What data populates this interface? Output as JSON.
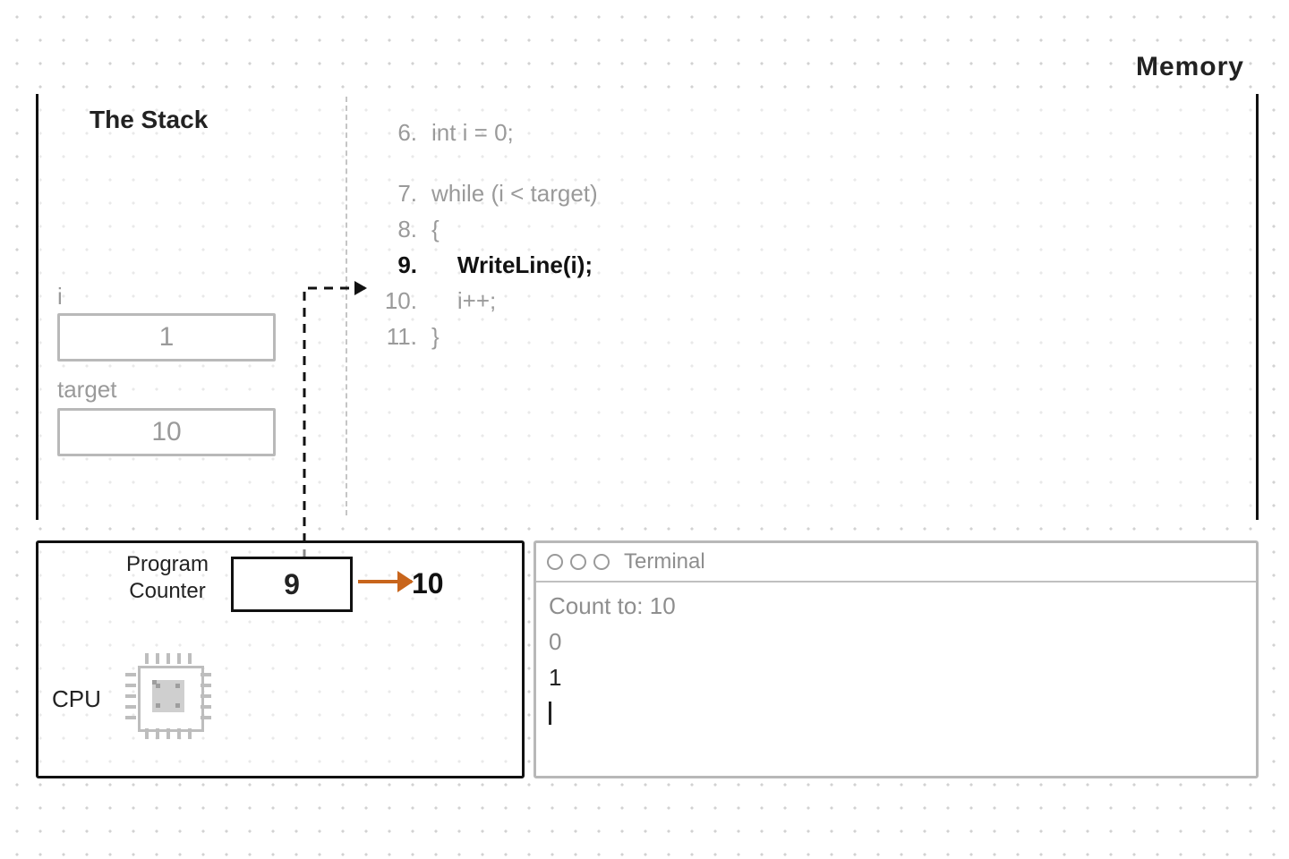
{
  "memory": {
    "panel_label": "Memory",
    "stack_title": "The Stack",
    "vars": {
      "i": {
        "label": "i",
        "value": "1"
      },
      "target": {
        "label": "target",
        "value": "10"
      }
    },
    "code": [
      {
        "n": "6.",
        "text": "int i = 0;",
        "active": false
      },
      {
        "n": "",
        "text": "",
        "active": false,
        "gap": true
      },
      {
        "n": "7.",
        "text": "while (i < target)",
        "active": false
      },
      {
        "n": "8.",
        "text": "{",
        "active": false
      },
      {
        "n": "9.",
        "text": "    WriteLine(i);",
        "active": true
      },
      {
        "n": "10.",
        "text": "    i++;",
        "active": false
      },
      {
        "n": "11.",
        "text": "}",
        "active": false
      }
    ]
  },
  "cpu": {
    "pc_label_line1": "Program",
    "pc_label_line2": "Counter",
    "pc_value": "9",
    "pc_next": "10",
    "cpu_label": "CPU"
  },
  "terminal": {
    "title": "Terminal",
    "lines": [
      {
        "text": "Count to: 10",
        "dim": true
      },
      {
        "text": "0",
        "dim": true
      },
      {
        "text": "1",
        "dim": false
      }
    ]
  }
}
